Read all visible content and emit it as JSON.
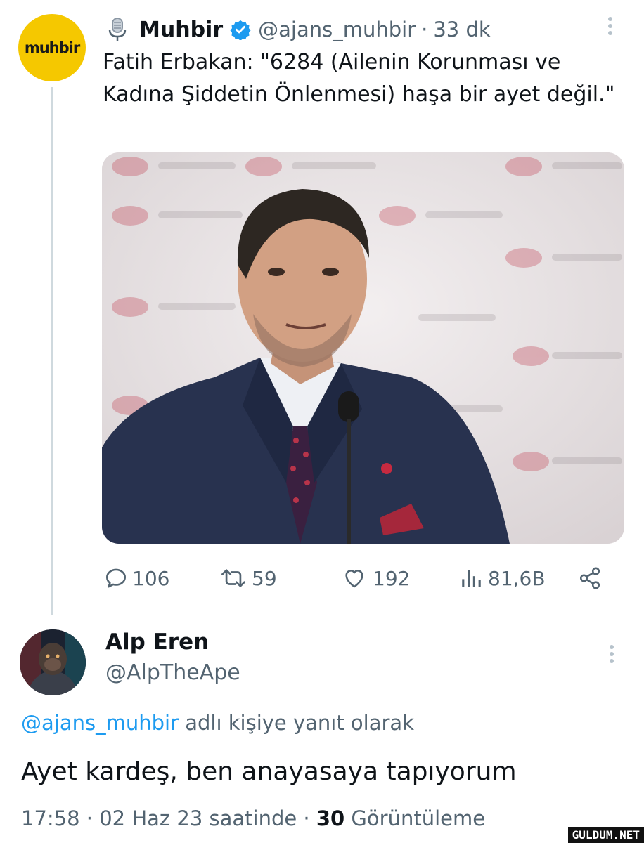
{
  "tweet": {
    "avatar_text": "muhbir",
    "author_name": "Muhbir",
    "handle": "@ajans_muhbir",
    "separator": "·",
    "time_ago": "33 dk",
    "text": "Fatih Erbakan: \"6284 (Ailenin Korunması ve Kadına Şiddetin Önlenmesi) haşa bir ayet değil.\"",
    "icons": [
      "microphone-icon",
      "verified-badge-icon",
      "more-options-icon"
    ],
    "stats": {
      "replies": "106",
      "retweets": "59",
      "likes": "192",
      "views": "81,6B"
    },
    "stat_icons": [
      "reply-icon",
      "retweet-icon",
      "like-icon",
      "views-icon",
      "share-icon"
    ]
  },
  "reply": {
    "author_name": "Alp Eren",
    "handle": "@AlpTheApe",
    "replying_to_mention": "@ajans_muhbir",
    "replying_to_suffix": " adlı kişiye yanıt olarak",
    "text": "Ayet kardeş, ben anayasaya tapıyorum",
    "time": "17:58",
    "separator": "·",
    "date": "02 Haz 23 saatinde",
    "views_count": "30",
    "views_label": " Görüntüleme"
  },
  "watermark": "GULDUM.NET",
  "colors": {
    "accent": "#1d9bf0",
    "avatar_yellow": "#f5c800",
    "secondary_text": "#536471"
  }
}
